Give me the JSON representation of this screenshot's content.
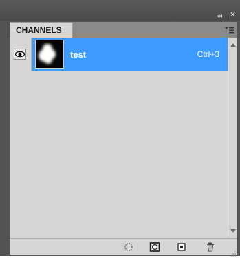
{
  "panel": {
    "tab_label": "CHANNELS",
    "collapse_glyph": "◂◂",
    "close_glyph": "✕"
  },
  "channels": [
    {
      "name": "test",
      "shortcut": "Ctrl+3",
      "visible": true,
      "selected": true
    }
  ],
  "toolbar": {
    "buttons": [
      "load-selection-icon",
      "save-selection-icon",
      "new-channel-icon",
      "trash-icon"
    ]
  },
  "colors": {
    "selection": "#3d9bff",
    "panel_bg": "#d6d6d6",
    "frame": "#535353"
  }
}
